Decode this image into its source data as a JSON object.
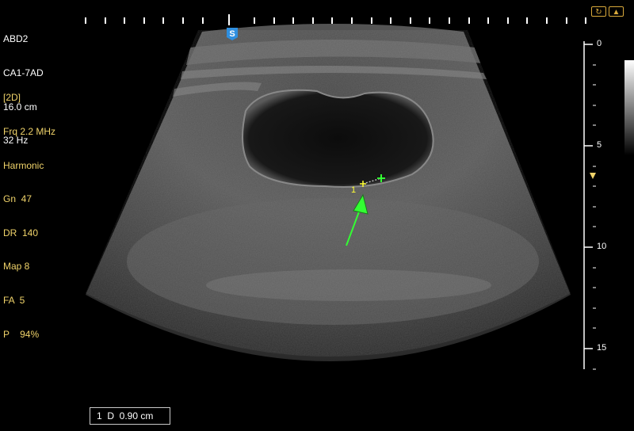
{
  "header": {
    "preset": "ABD2",
    "probe": "CA1-7AD",
    "depth": "16.0 cm",
    "frame_rate": "32 Hz"
  },
  "params": {
    "mode": "[2D]",
    "frequency": "Frq 2.2 MHz",
    "harmonic": "Harmonic",
    "gain": "Gn  47",
    "dynamic_range": "DR  140",
    "map": "Map 8",
    "frame_avg": "FA  5",
    "power": "P    94%"
  },
  "orientation_marker": "S",
  "depth_scale": {
    "labels": [
      "0",
      "5",
      "10",
      "15"
    ],
    "max_cm": 16.0
  },
  "caliper": {
    "index_label": "1"
  },
  "measurement": {
    "result": "1  D  0.90 cm"
  },
  "colors": {
    "text_white": "#ffffff",
    "text_yellow": "#f0d36a",
    "caliper_green": "#33ff33",
    "caliper_yellow": "#ffff33",
    "marker_blue": "#2f8fe0",
    "icon_gold": "#d9a93b"
  },
  "icons": {
    "cine_left": "cine-loop-icon",
    "cine_right": "biopsy-icon"
  }
}
